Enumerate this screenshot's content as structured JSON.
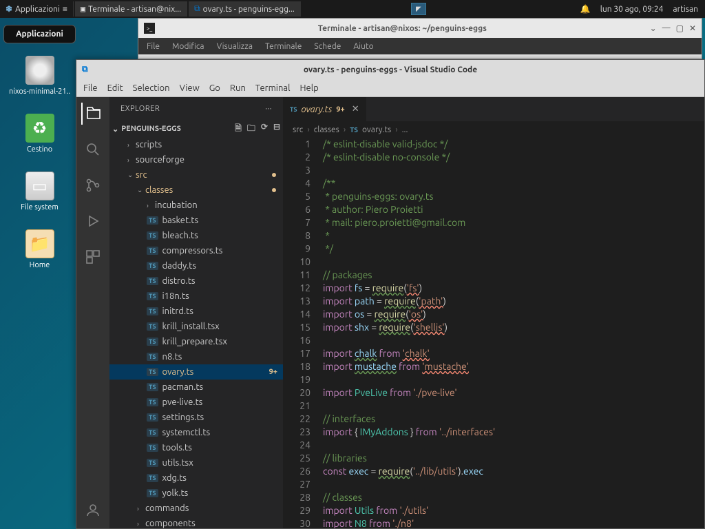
{
  "os_panel": {
    "apps_button": "Applicazioni",
    "taskbar_terminal": "Terminale - artisan@nix...",
    "taskbar_vscode": "ovary.ts - penguins-egg...",
    "clock": "lun 30 ago, 09:24",
    "user": "artisan"
  },
  "desktop": {
    "apps_menu": "Applicazioni",
    "icons": [
      {
        "label": "nixos-minimal-21..",
        "type": "disc"
      },
      {
        "label": "Cestino",
        "type": "trash"
      },
      {
        "label": "File system",
        "type": "fs"
      },
      {
        "label": "Home",
        "type": "home"
      }
    ]
  },
  "terminal": {
    "title": "Terminale - artisan@nixos: ~/penguins-eggs",
    "menus": [
      "File",
      "Modifica",
      "Visualizza",
      "Terminale",
      "Schede",
      "Aiuto"
    ]
  },
  "vscode": {
    "title": "ovary.ts - penguins-eggs - Visual Studio Code",
    "menus": [
      "File",
      "Edit",
      "Selection",
      "View",
      "Go",
      "Run",
      "Terminal",
      "Help"
    ],
    "explorer": {
      "header": "EXPLORER",
      "root": "PENGUINS-EGGS",
      "tree": [
        {
          "label": "scripts",
          "type": "folder",
          "depth": 1,
          "chev": "›"
        },
        {
          "label": "sourceforge",
          "type": "folder",
          "depth": 1,
          "chev": "›"
        },
        {
          "label": "src",
          "type": "folder",
          "depth": 1,
          "chev": "⌄",
          "modified": true,
          "dot": true
        },
        {
          "label": "classes",
          "type": "folder",
          "depth": 2,
          "chev": "⌄",
          "modified": true,
          "dot": true
        },
        {
          "label": "incubation",
          "type": "folder",
          "depth": 3,
          "chev": "›"
        },
        {
          "label": "basket.ts",
          "type": "ts",
          "depth": 3
        },
        {
          "label": "bleach.ts",
          "type": "ts",
          "depth": 3
        },
        {
          "label": "compressors.ts",
          "type": "ts",
          "depth": 3
        },
        {
          "label": "daddy.ts",
          "type": "ts",
          "depth": 3
        },
        {
          "label": "distro.ts",
          "type": "ts",
          "depth": 3
        },
        {
          "label": "i18n.ts",
          "type": "ts",
          "depth": 3
        },
        {
          "label": "initrd.ts",
          "type": "ts",
          "depth": 3
        },
        {
          "label": "krill_install.tsx",
          "type": "ts",
          "depth": 3
        },
        {
          "label": "krill_prepare.tsx",
          "type": "ts",
          "depth": 3
        },
        {
          "label": "n8.ts",
          "type": "ts",
          "depth": 3
        },
        {
          "label": "ovary.ts",
          "type": "ts",
          "depth": 3,
          "selected": true,
          "modified": true,
          "badge": "9+"
        },
        {
          "label": "pacman.ts",
          "type": "ts",
          "depth": 3
        },
        {
          "label": "pve-live.ts",
          "type": "ts",
          "depth": 3
        },
        {
          "label": "settings.ts",
          "type": "ts",
          "depth": 3
        },
        {
          "label": "systemctl.ts",
          "type": "ts",
          "depth": 3
        },
        {
          "label": "tools.ts",
          "type": "ts",
          "depth": 3
        },
        {
          "label": "utils.tsx",
          "type": "ts",
          "depth": 3
        },
        {
          "label": "xdg.ts",
          "type": "ts",
          "depth": 3
        },
        {
          "label": "yolk.ts",
          "type": "ts",
          "depth": 3
        },
        {
          "label": "commands",
          "type": "folder",
          "depth": 2,
          "chev": "›"
        },
        {
          "label": "components",
          "type": "folder",
          "depth": 2,
          "chev": "›"
        }
      ]
    },
    "tab": {
      "name": "ovary.ts",
      "badge": "9+"
    },
    "breadcrumb": [
      "src",
      "classes",
      "ovary.ts",
      "..."
    ],
    "code_lines": [
      [
        {
          "t": "/* eslint-disable valid-jsdoc */",
          "c": "c-comment"
        }
      ],
      [
        {
          "t": "/* eslint-disable no-console */",
          "c": "c-comment"
        }
      ],
      [
        {
          "t": "",
          "c": ""
        }
      ],
      [
        {
          "t": "/**",
          "c": "c-comment"
        }
      ],
      [
        {
          "t": " * penguins-eggs: ovary.ts",
          "c": "c-comment"
        }
      ],
      [
        {
          "t": " * author: Piero Proietti",
          "c": "c-comment"
        }
      ],
      [
        {
          "t": " * mail: piero.proietti@gmail.com",
          "c": "c-comment"
        }
      ],
      [
        {
          "t": " *",
          "c": "c-comment"
        }
      ],
      [
        {
          "t": " */",
          "c": "c-comment"
        }
      ],
      [
        {
          "t": "",
          "c": ""
        }
      ],
      [
        {
          "t": "// packages",
          "c": "c-comment"
        }
      ],
      [
        {
          "t": "import",
          "c": "c-keyword"
        },
        {
          "t": " "
        },
        {
          "t": "fs",
          "c": "c-var"
        },
        {
          "t": " = "
        },
        {
          "t": "require",
          "c": "c-func underline-wavy"
        },
        {
          "t": "("
        },
        {
          "t": "'fs'",
          "c": "c-string underline-wavy-err"
        },
        {
          "t": ")"
        }
      ],
      [
        {
          "t": "import",
          "c": "c-keyword"
        },
        {
          "t": " "
        },
        {
          "t": "path",
          "c": "c-var"
        },
        {
          "t": " = "
        },
        {
          "t": "require",
          "c": "c-func underline-wavy"
        },
        {
          "t": "("
        },
        {
          "t": "'path'",
          "c": "c-string underline-wavy-err"
        },
        {
          "t": ")"
        }
      ],
      [
        {
          "t": "import",
          "c": "c-keyword"
        },
        {
          "t": " "
        },
        {
          "t": "os",
          "c": "c-var"
        },
        {
          "t": " = "
        },
        {
          "t": "require",
          "c": "c-func underline-wavy"
        },
        {
          "t": "("
        },
        {
          "t": "'os'",
          "c": "c-string underline-wavy-err"
        },
        {
          "t": ")"
        }
      ],
      [
        {
          "t": "import",
          "c": "c-keyword"
        },
        {
          "t": " "
        },
        {
          "t": "shx",
          "c": "c-var"
        },
        {
          "t": " = "
        },
        {
          "t": "require",
          "c": "c-func underline-wavy"
        },
        {
          "t": "("
        },
        {
          "t": "'shelljs'",
          "c": "c-string underline-wavy-err"
        },
        {
          "t": ")"
        }
      ],
      [
        {
          "t": "",
          "c": ""
        }
      ],
      [
        {
          "t": "import",
          "c": "c-keyword"
        },
        {
          "t": " "
        },
        {
          "t": "chalk",
          "c": "c-var underline-wavy"
        },
        {
          "t": " "
        },
        {
          "t": "from",
          "c": "c-keyword"
        },
        {
          "t": " "
        },
        {
          "t": "'chalk'",
          "c": "c-string underline-wavy-err"
        }
      ],
      [
        {
          "t": "import",
          "c": "c-keyword"
        },
        {
          "t": " "
        },
        {
          "t": "mustache",
          "c": "c-var underline-wavy"
        },
        {
          "t": " "
        },
        {
          "t": "from",
          "c": "c-keyword"
        },
        {
          "t": " "
        },
        {
          "t": "'mustache'",
          "c": "c-string underline-wavy-err"
        }
      ],
      [
        {
          "t": "",
          "c": ""
        }
      ],
      [
        {
          "t": "import",
          "c": "c-keyword"
        },
        {
          "t": " "
        },
        {
          "t": "PveLive",
          "c": "c-type"
        },
        {
          "t": " "
        },
        {
          "t": "from",
          "c": "c-keyword"
        },
        {
          "t": " "
        },
        {
          "t": "'./pve-live'",
          "c": "c-string"
        }
      ],
      [
        {
          "t": "",
          "c": ""
        }
      ],
      [
        {
          "t": "// interfaces",
          "c": "c-comment"
        }
      ],
      [
        {
          "t": "import",
          "c": "c-keyword"
        },
        {
          "t": " { "
        },
        {
          "t": "IMyAddons",
          "c": "c-type"
        },
        {
          "t": " } "
        },
        {
          "t": "from",
          "c": "c-keyword"
        },
        {
          "t": " "
        },
        {
          "t": "'../interfaces'",
          "c": "c-string"
        }
      ],
      [
        {
          "t": "",
          "c": ""
        }
      ],
      [
        {
          "t": "// libraries",
          "c": "c-comment"
        }
      ],
      [
        {
          "t": "const",
          "c": "c-keyword"
        },
        {
          "t": " "
        },
        {
          "t": "exec",
          "c": "c-var"
        },
        {
          "t": " = "
        },
        {
          "t": "require",
          "c": "c-func underline-wavy"
        },
        {
          "t": "("
        },
        {
          "t": "'../lib/utils'",
          "c": "c-string"
        },
        {
          "t": ")."
        },
        {
          "t": "exec",
          "c": "c-var"
        }
      ],
      [
        {
          "t": "",
          "c": ""
        }
      ],
      [
        {
          "t": "// classes",
          "c": "c-comment"
        }
      ],
      [
        {
          "t": "import",
          "c": "c-keyword"
        },
        {
          "t": " "
        },
        {
          "t": "Utils",
          "c": "c-type"
        },
        {
          "t": " "
        },
        {
          "t": "from",
          "c": "c-keyword"
        },
        {
          "t": " "
        },
        {
          "t": "'./utils'",
          "c": "c-string"
        }
      ],
      [
        {
          "t": "import",
          "c": "c-keyword"
        },
        {
          "t": " "
        },
        {
          "t": "N8",
          "c": "c-type"
        },
        {
          "t": " "
        },
        {
          "t": "from",
          "c": "c-keyword"
        },
        {
          "t": " "
        },
        {
          "t": "'./n8'",
          "c": "c-string"
        }
      ]
    ]
  }
}
